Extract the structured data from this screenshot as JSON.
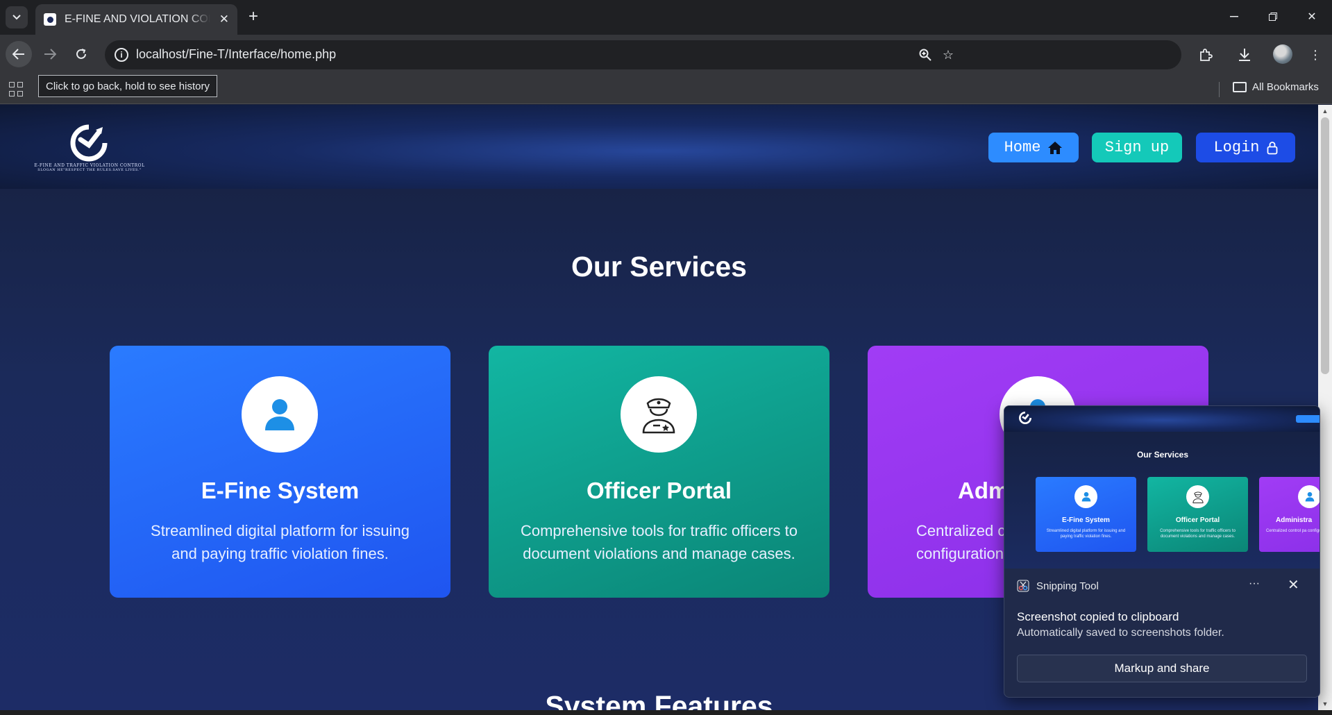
{
  "browser": {
    "tab_title": "E-FINE AND VIOLATION CONTROL",
    "new_tab_label": "+",
    "url": "localhost/Fine-T/Interface/home.php",
    "tooltip": "Click to go back, hold to see history",
    "all_bookmarks": "All Bookmarks"
  },
  "site": {
    "logo_line1": "E-FINE AND TRAFFIC VIOLATION CONTROL",
    "logo_line2": "SLOGAN HE\"RESPECT THE RULES.SAVE LIVES.\"",
    "nav": {
      "home": "Home",
      "signup": "Sign up",
      "login": "Login"
    },
    "services_title": "Our Services",
    "features_title": "System Features",
    "services": [
      {
        "title": "E-Fine System",
        "description": "Streamlined digital platform for issuing and paying traffic violation fines."
      },
      {
        "title": "Officer Portal",
        "description": "Comprehensive tools for traffic officers to document violations and manage cases."
      },
      {
        "title": "Adm",
        "description": "Centralized c configuration"
      }
    ]
  },
  "snipping": {
    "app_name": "Snipping Tool",
    "more_label": "···",
    "message": "Screenshot copied to clipboard",
    "sub_message": "Automatically saved to screenshots folder.",
    "action_label": "Markup and share",
    "thumbnail": {
      "title": "Our Services",
      "cards": [
        {
          "title": "E-Fine System",
          "description": "Streamlined digital platform for issuing and paying traffic violation fines."
        },
        {
          "title": "Officer Portal",
          "description": "Comprehensive tools for traffic officers to document violations and manage cases."
        },
        {
          "title": "Administra",
          "description": "Centralized control pa configuration and user"
        }
      ]
    }
  },
  "colors": {
    "home_button": "#2d8cff",
    "signup_button": "#14c9b9",
    "login_button": "#1d4ce6",
    "card_blue": "#2a7bff",
    "card_teal": "#12b6a2",
    "card_purple": "#a13cf5"
  },
  "icons": {
    "home": "home-icon",
    "login": "lock-icon",
    "card1": "user-icon",
    "card2": "police-officer-icon",
    "card3": "admin-icon"
  }
}
